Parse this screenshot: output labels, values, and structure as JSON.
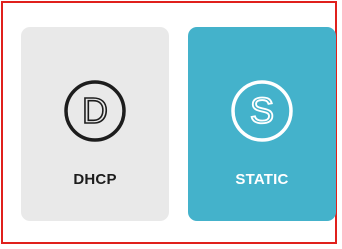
{
  "options": [
    {
      "label": "DHCP",
      "icon": "letter-d-circle-icon",
      "selected": false,
      "glyph": "D"
    },
    {
      "label": "STATIC",
      "icon": "letter-s-circle-icon",
      "selected": true,
      "glyph": "S"
    }
  ],
  "colors": {
    "frame_border": "#e0201c",
    "unselected_bg": "#e9e9e9",
    "selected_bg": "#44b2cb",
    "unselected_text": "#1d1d1d",
    "selected_text": "#ffffff"
  }
}
